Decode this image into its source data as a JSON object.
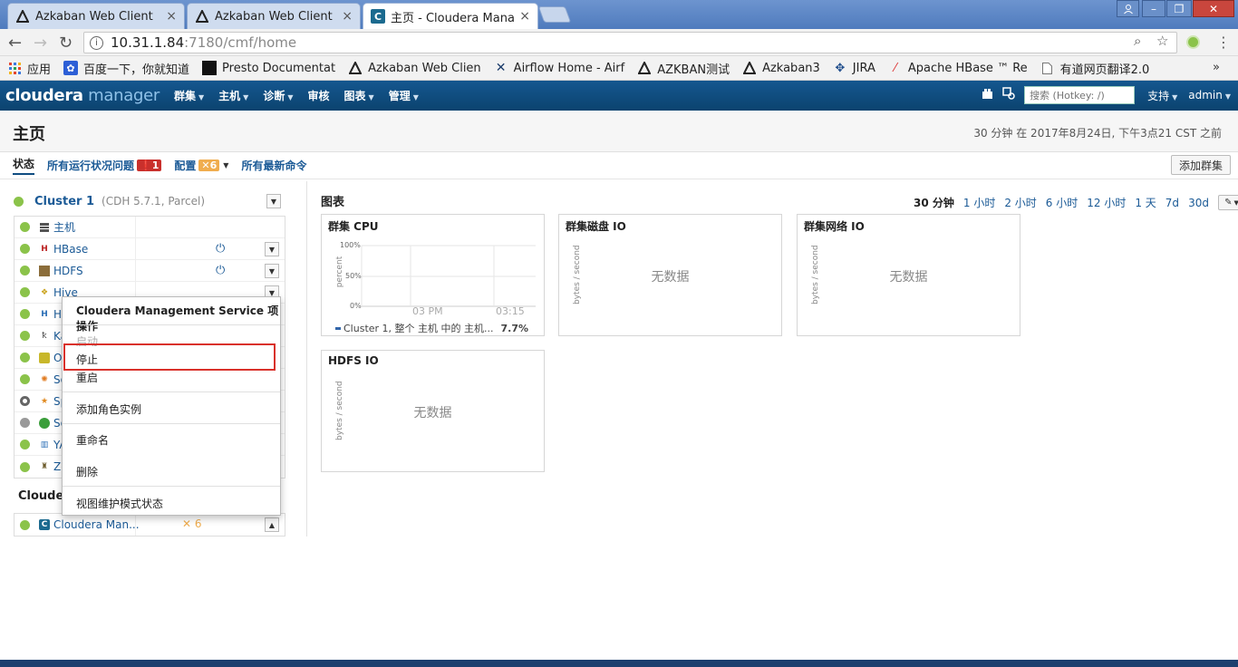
{
  "browser": {
    "tabs": [
      {
        "label": "Azkaban Web Client",
        "icon": "azkaban-icon",
        "active": false
      },
      {
        "label": "Azkaban Web Client",
        "icon": "azkaban-icon",
        "active": false
      },
      {
        "label": "主页 - Cloudera Manag",
        "icon": "cloudera-icon",
        "active": true
      }
    ],
    "url_host": "10.31.1.84",
    "url_path": ":7180/cmf/home",
    "bookmarks": [
      {
        "label": "应用",
        "icon": "apps-grid-icon"
      },
      {
        "label": "百度一下，你就知道",
        "icon": "baidu-paw-icon"
      },
      {
        "label": "Presto Documentat",
        "icon": "presto-icon"
      },
      {
        "label": "Azkaban Web Clien",
        "icon": "azkaban-icon"
      },
      {
        "label": "Airflow Home - Airf",
        "icon": "airflow-icon"
      },
      {
        "label": "AZKBAN测试",
        "icon": "azkaban-icon"
      },
      {
        "label": "Azkaban3",
        "icon": "azkaban-icon"
      },
      {
        "label": "JIRA",
        "icon": "jira-icon"
      },
      {
        "label": "Apache HBase ™ Re",
        "icon": "hbase-feather-icon"
      },
      {
        "label": "有道网页翻译2.0",
        "icon": "document-icon"
      }
    ]
  },
  "navbar": {
    "logo_a": "cloudera",
    "logo_b": " manager",
    "items": [
      "群集",
      "主机",
      "诊断",
      "审核",
      "图表",
      "管理"
    ],
    "search_placeholder": "搜索 (Hotkey: /)",
    "support": "支持",
    "user": "admin"
  },
  "header": {
    "title": "主页",
    "time": "30 分钟 在 2017年8月24日, 下午3点21 CST 之前"
  },
  "subnav": {
    "status": "状态",
    "health_issues": "所有运行状况问题",
    "health_count": "1",
    "config": "配置",
    "config_count": "6",
    "commands": "所有最新命令",
    "add_cluster": "添加群集"
  },
  "cluster": {
    "name": "Cluster 1",
    "version": "(CDH 5.7.1, Parcel)",
    "services": [
      {
        "name": "主机",
        "icon": "hosts-icon"
      },
      {
        "name": "HBase",
        "icon": "hbase-icon"
      },
      {
        "name": "HDFS",
        "icon": "hdfs-icon"
      },
      {
        "name": "Hive",
        "icon": "hive-icon"
      },
      {
        "name": "Hu",
        "icon": "hue-icon"
      },
      {
        "name": "Ka",
        "icon": "kafka-icon"
      },
      {
        "name": "Oo",
        "icon": "oozie-icon"
      },
      {
        "name": "So",
        "icon": "solr-icon"
      },
      {
        "name": "Sp",
        "icon": "spark-icon"
      },
      {
        "name": "Sq",
        "icon": "sqoop-icon"
      },
      {
        "name": "YA",
        "icon": "yarn-icon"
      },
      {
        "name": "Zo",
        "icon": "zookeeper-icon"
      }
    ]
  },
  "cms": {
    "heading": "Cloudera",
    "service": "Cloudera Man...",
    "config_count": "6"
  },
  "menu": {
    "title": "Cloudera Management Service 项操作",
    "start": "启动",
    "stop": "停止",
    "restart": "重启",
    "add_role": "添加角色实例",
    "rename": "重命名",
    "delete": "删除",
    "maintenance": "视图维护模式状态"
  },
  "charts": {
    "title": "图表",
    "ranges": [
      "30 分钟",
      "1 小时",
      "2 小时",
      "6 小时",
      "12 小时",
      "1 天",
      "7d",
      "30d"
    ],
    "cpu": {
      "title": "群集 CPU",
      "ylabel": "percent",
      "yticks": [
        "100%",
        "50%",
        "0%"
      ],
      "xticks": [
        "03 PM",
        "03:15"
      ],
      "legend": "Cluster 1, 整个 主机 中的 主机...",
      "legend_value": "7.7%"
    },
    "disk": {
      "title": "群集磁盘 IO",
      "ylabel": "bytes / second",
      "empty": "无数据"
    },
    "net": {
      "title": "群集网络 IO",
      "ylabel": "bytes / second",
      "empty": "无数据"
    },
    "hdfs": {
      "title": "HDFS IO",
      "ylabel": "bytes / second",
      "empty": "无数据"
    }
  },
  "colors": {
    "navbar": "#0f4c81",
    "accent_link": "#1b5a96",
    "health_good": "#8bc34a",
    "alert_red": "#c9302c",
    "warn_yellow": "#f0ad4e",
    "highlight_box": "#d9312b"
  }
}
